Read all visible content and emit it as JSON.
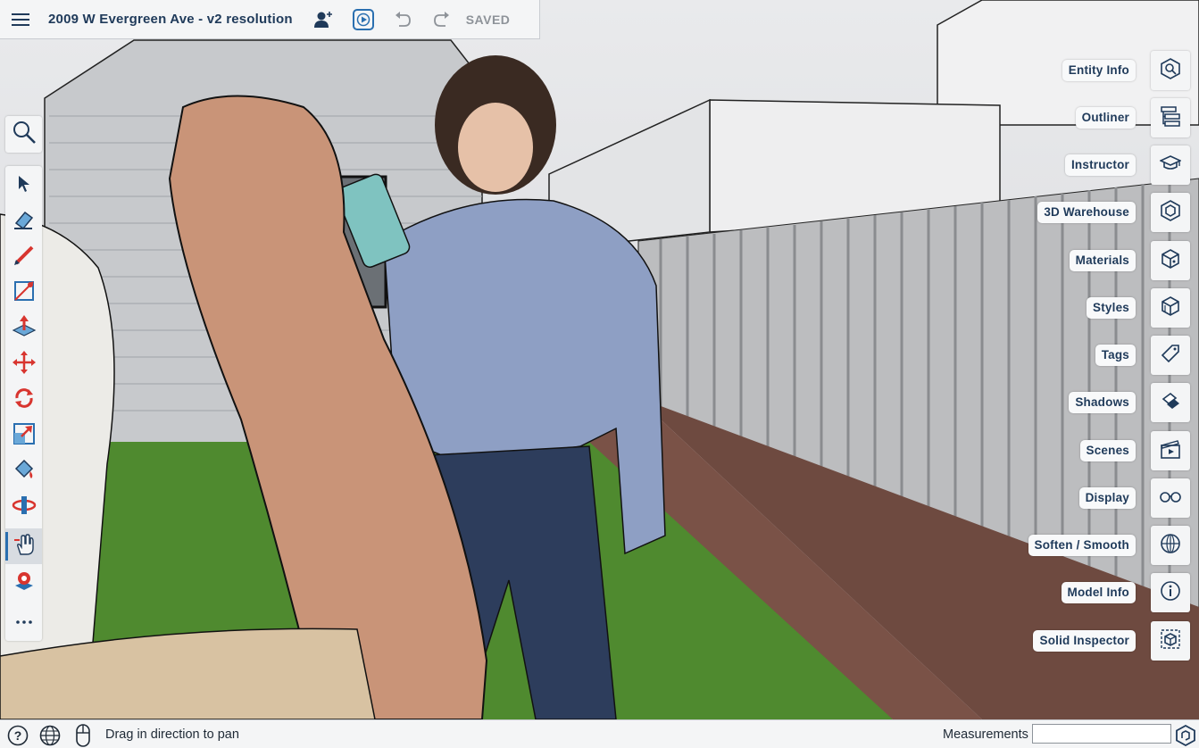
{
  "header": {
    "title": "2009 W Evergreen Ave - v2 resolution",
    "saved_label": "SAVED"
  },
  "icons": {
    "menu": "hamburger-icon",
    "collaborators": "add-user-icon",
    "present": "play-icon",
    "undo": "undo-icon",
    "redo": "redo-icon"
  },
  "left_toolbar": {
    "search_tool": "search-icon",
    "tools": [
      {
        "name": "select",
        "icon": "arrow-cursor-icon"
      },
      {
        "name": "eraser",
        "icon": "eraser-icon"
      },
      {
        "name": "pencil",
        "icon": "pencil-icon"
      },
      {
        "name": "shape",
        "icon": "rectangle-icon"
      },
      {
        "name": "push-pull",
        "icon": "push-pull-icon"
      },
      {
        "name": "move",
        "icon": "move-icon"
      },
      {
        "name": "rotate",
        "icon": "rotate-icon"
      },
      {
        "name": "scale",
        "icon": "scale-icon"
      },
      {
        "name": "paint-bucket",
        "icon": "paint-bucket-icon"
      },
      {
        "name": "orbit",
        "icon": "orbit-icon"
      },
      {
        "name": "pan",
        "icon": "pan-hand-icon",
        "active": true
      },
      {
        "name": "position-camera",
        "icon": "position-camera-icon"
      },
      {
        "name": "more",
        "icon": "more-dots-icon"
      }
    ]
  },
  "right_panels": [
    {
      "label": "Entity Info",
      "icon": "entity-info-icon"
    },
    {
      "label": "Outliner",
      "icon": "outliner-icon"
    },
    {
      "label": "Instructor",
      "icon": "graduation-cap-icon"
    },
    {
      "label": "3D Warehouse",
      "icon": "warehouse-icon"
    },
    {
      "label": "Materials",
      "icon": "materials-cube-icon"
    },
    {
      "label": "Styles",
      "icon": "styles-cube-icon"
    },
    {
      "label": "Tags",
      "icon": "tag-icon"
    },
    {
      "label": "Shadows",
      "icon": "shadow-icon"
    },
    {
      "label": "Scenes",
      "icon": "clapperboard-icon"
    },
    {
      "label": "Display",
      "icon": "glasses-icon"
    },
    {
      "label": "Soften / Smooth",
      "icon": "soften-sphere-icon"
    },
    {
      "label": "Model Info",
      "icon": "info-icon"
    },
    {
      "label": "Solid Inspector",
      "icon": "solid-inspector-icon"
    }
  ],
  "statusbar": {
    "help_icon": "help-icon",
    "geo_icon": "globe-icon",
    "mouse_icon": "mouse-icon",
    "status_text": "Drag in direction to pan",
    "measurements_label": "Measurements",
    "measurements_value": "",
    "logo_icon": "sketchup-logo-icon"
  },
  "colors": {
    "accent": "#2a6fb0",
    "label_text": "#1f3a5a",
    "toolbar_bg": "#f4f5f6"
  }
}
